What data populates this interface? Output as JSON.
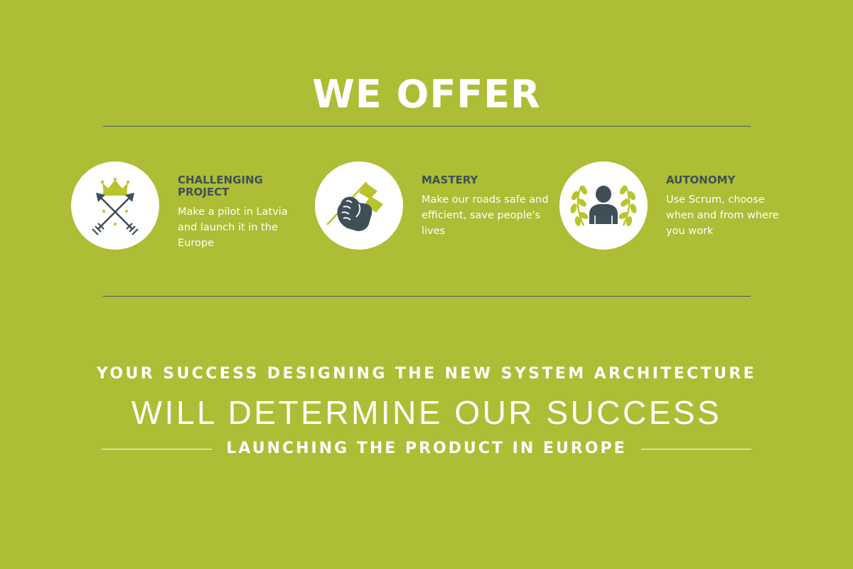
{
  "header": {
    "title": "WE OFFER"
  },
  "colors": {
    "background": "#adbd35",
    "accent": "#b8c42a",
    "dark": "#404f57",
    "text_light": "#ffffff"
  },
  "features": [
    {
      "icon": "crossed-arrows-crown-icon",
      "title": "CHALLENGING PROJECT",
      "description": "Make a pilot in Latvia and launch it in the Europe"
    },
    {
      "icon": "fist-flag-icon",
      "title": "MASTERY",
      "description": "Make our roads safe and efficient, save people's lives"
    },
    {
      "icon": "person-laurel-icon",
      "title": "AUTONOMY",
      "description": "Use Scrum, choose when and from where you work"
    }
  ],
  "tagline": {
    "line1": "YOUR SUCCESS DESIGNING THE NEW SYSTEM ARCHITECTURE",
    "line2": "WILL DETERMINE OUR SUCCESS",
    "line3": "LAUNCHING THE PRODUCT IN EUROPE"
  }
}
